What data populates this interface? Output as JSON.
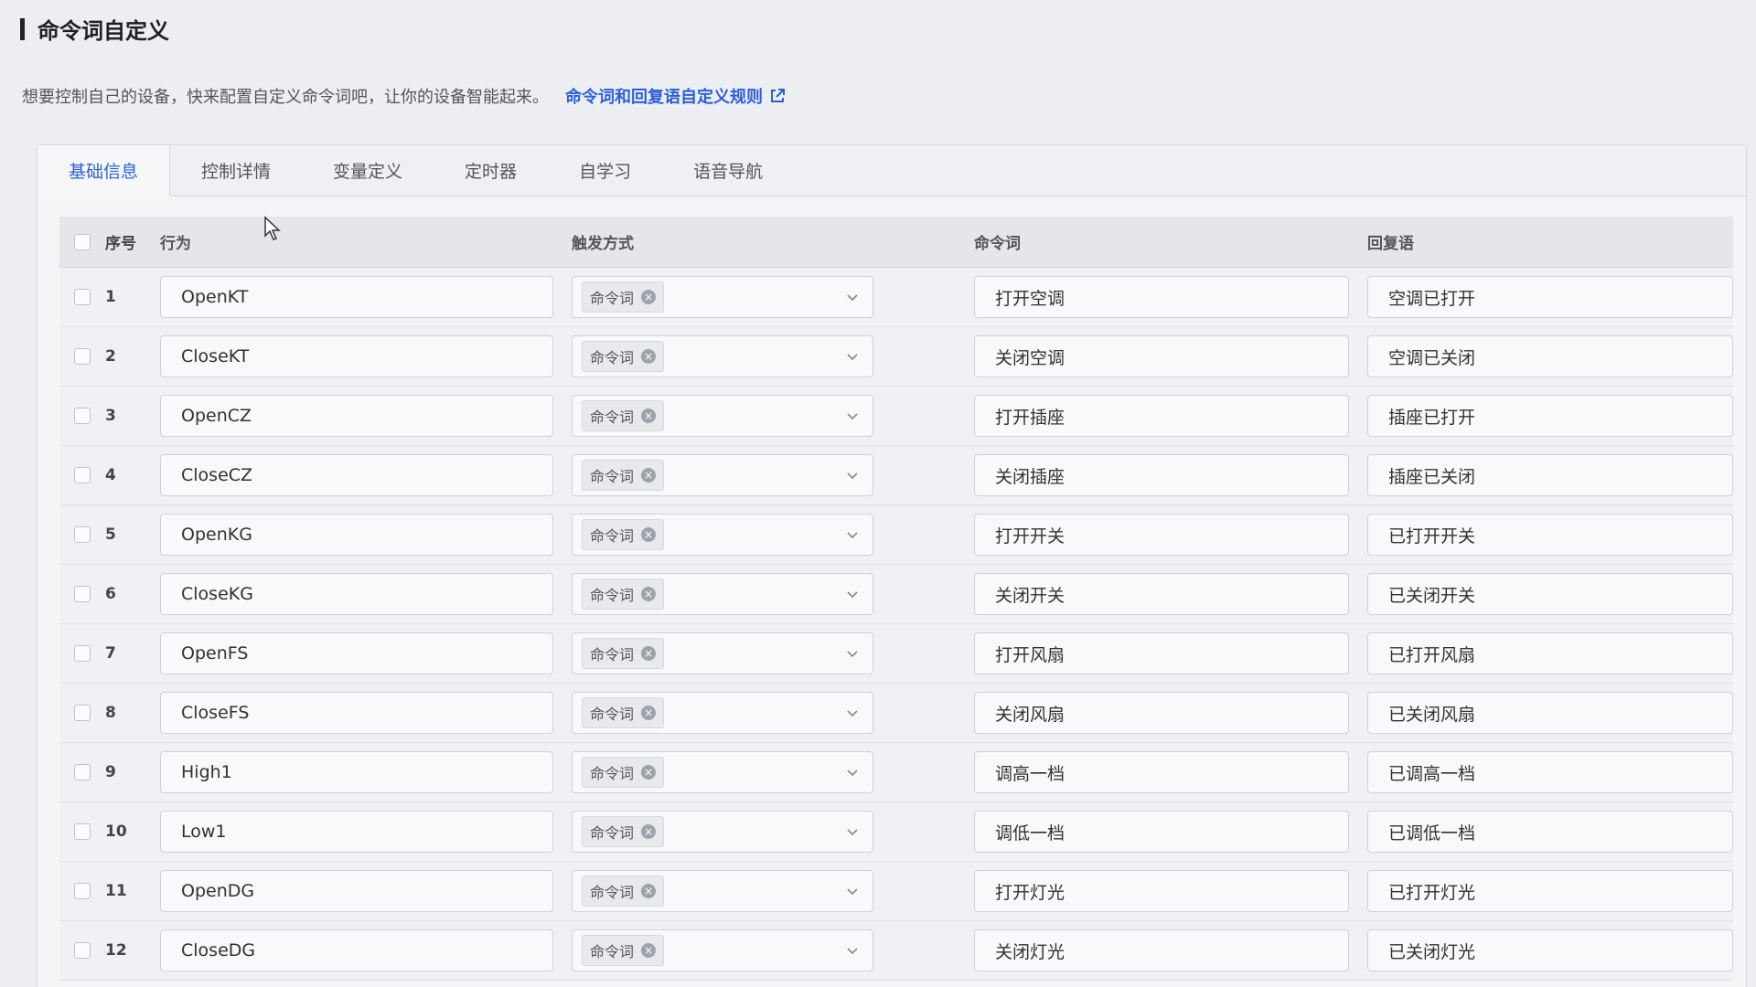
{
  "page": {
    "title": "命令词自定义",
    "intro": "想要控制自己的设备，快来配置自定义命令词吧，让你的设备智能起来。",
    "rule_link": "命令词和回复语自定义规则"
  },
  "tabs": [
    {
      "label": "基础信息"
    },
    {
      "label": "控制详情"
    },
    {
      "label": "变量定义"
    },
    {
      "label": "定时器"
    },
    {
      "label": "自学习"
    },
    {
      "label": "语音导航"
    }
  ],
  "table": {
    "headers": {
      "index": "序号",
      "action": "行为",
      "trigger": "触发方式",
      "command": "命令词",
      "reply": "回复语"
    },
    "rows": [
      {
        "index": "1",
        "action": "OpenKT",
        "trigger": "命令词",
        "command": "打开空调",
        "reply": "空调已打开"
      },
      {
        "index": "2",
        "action": "CloseKT",
        "trigger": "命令词",
        "command": "关闭空调",
        "reply": "空调已关闭"
      },
      {
        "index": "3",
        "action": "OpenCZ",
        "trigger": "命令词",
        "command": "打开插座",
        "reply": "插座已打开"
      },
      {
        "index": "4",
        "action": "CloseCZ",
        "trigger": "命令词",
        "command": "关闭插座",
        "reply": "插座已关闭"
      },
      {
        "index": "5",
        "action": "OpenKG",
        "trigger": "命令词",
        "command": "打开开关",
        "reply": "已打开开关"
      },
      {
        "index": "6",
        "action": "CloseKG",
        "trigger": "命令词",
        "command": "关闭开关",
        "reply": "已关闭开关"
      },
      {
        "index": "7",
        "action": "OpenFS",
        "trigger": "命令词",
        "command": "打开风扇",
        "reply": "已打开风扇"
      },
      {
        "index": "8",
        "action": "CloseFS",
        "trigger": "命令词",
        "command": "关闭风扇",
        "reply": "已关闭风扇"
      },
      {
        "index": "9",
        "action": "High1",
        "trigger": "命令词",
        "command": "调高一档",
        "reply": "已调高一档"
      },
      {
        "index": "10",
        "action": "Low1",
        "trigger": "命令词",
        "command": "调低一档",
        "reply": "已调低一档"
      },
      {
        "index": "11",
        "action": "OpenDG",
        "trigger": "命令词",
        "command": "打开灯光",
        "reply": "已打开灯光"
      },
      {
        "index": "12",
        "action": "CloseDG",
        "trigger": "命令词",
        "command": "关闭灯光",
        "reply": "已关闭灯光"
      }
    ]
  },
  "colors": {
    "accent": "#2b63d8",
    "link": "#2b5fd9"
  }
}
